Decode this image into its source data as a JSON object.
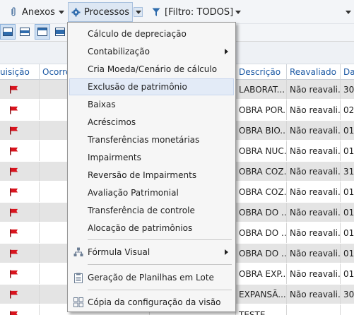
{
  "toolbar": {
    "anexos_label": "Anexos",
    "processos_label": "Processos",
    "filter_label": "[Filtro: TODOS]"
  },
  "grid": {
    "headers": {
      "aquisicao": "uisição",
      "ocorrencia": "Ocorrê",
      "descricao": "Descrição",
      "reavaliado": "Reavaliado",
      "data": "Dat"
    },
    "rows": [
      {
        "descricao": "LABORAT...",
        "reavaliado": "Não reavali...",
        "data": "30"
      },
      {
        "descricao": "OBRA POR...",
        "reavaliado": "Não reavali...",
        "data": "02"
      },
      {
        "descricao": "OBRA BIO...",
        "reavaliado": "Não reavali...",
        "data": "01"
      },
      {
        "descricao": "OBRA NUC...",
        "reavaliado": "Não reavali...",
        "data": "01"
      },
      {
        "descricao": "OBRA COZ...",
        "reavaliado": "Não reavali...",
        "data": "31"
      },
      {
        "descricao": "OBRA COZ...",
        "reavaliado": "Não reavali...",
        "data": "01"
      },
      {
        "descricao": "OBRA DO ...",
        "reavaliado": "Não reavali...",
        "data": "01"
      },
      {
        "descricao": "OBRA DO ...",
        "reavaliado": "Não reavali...",
        "data": "01"
      },
      {
        "descricao": "OBRA DO ...",
        "reavaliado": "Não reavali...",
        "data": "01"
      },
      {
        "descricao": "OBRA EXP...",
        "reavaliado": "Não reavali...",
        "data": "01"
      },
      {
        "descricao": "EXPANSÃ...",
        "reavaliado": "Não reavali...",
        "data": "30"
      },
      {
        "descricao": "TESTE",
        "reavaliado": "",
        "data": ""
      }
    ]
  },
  "menu": {
    "items": [
      {
        "label": "Cálculo de depreciação"
      },
      {
        "label": "Contabilização"
      },
      {
        "label": "Cria Moeda/Cenário de cálculo"
      },
      {
        "label": "Exclusão de patrimônio"
      },
      {
        "label": "Baixas"
      },
      {
        "label": "Acréscimos"
      },
      {
        "label": "Transferências monetárias"
      },
      {
        "label": "Impairments"
      },
      {
        "label": "Reversão de Impairments"
      },
      {
        "label": "Avaliação Patrimonial"
      },
      {
        "label": "Transferência de controle"
      },
      {
        "label": "Alocação de patrimônios"
      },
      {
        "label": "Fórmula Visual"
      },
      {
        "label": "Geração de Planilhas em Lote"
      },
      {
        "label": "Cópia da configuração da visão"
      }
    ]
  },
  "colors": {
    "flag": "#d9141e",
    "header_text": "#1d5aa5",
    "menu_highlight": "#e3ebf7"
  }
}
